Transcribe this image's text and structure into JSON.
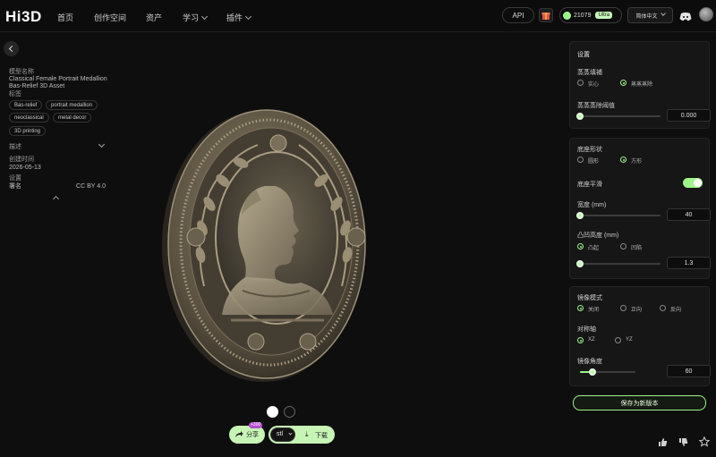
{
  "brand": {
    "logo": "Hi3D"
  },
  "nav": {
    "items": [
      {
        "label": "首页"
      },
      {
        "label": "创作空间"
      },
      {
        "label": "资产"
      },
      {
        "label": "学习"
      },
      {
        "label": "插件"
      }
    ]
  },
  "header": {
    "api_label": "API",
    "credits": "21079",
    "plan_badge": "Ultra",
    "language": "简体中文"
  },
  "asset": {
    "name_label": "模型名称",
    "name_value": "Classical Female Portrait Medallion Bas-Relief 3D Asset",
    "tags_label": "标签",
    "tags": [
      "Bas-relief",
      "portrait medallion",
      "neoclassical",
      "metal decor",
      "3D printing"
    ],
    "desc_label": "描述",
    "created_label": "创建时间",
    "created_value": "2026-05-13",
    "settings_label": "设置",
    "license_type": "署名",
    "license_value": "CC BY 4.0"
  },
  "settings": {
    "title": "设置",
    "fill_mode_label": "蒸蒸填補",
    "fill_options": [
      "实心",
      "蒸蒸蒸除"
    ],
    "fill_selected": 1,
    "threshold_label": "蒸蒸蒸除阈值",
    "threshold_value": "0.000",
    "threshold_level": 0,
    "base_shape_label": "底座形状",
    "shape_options": [
      "圆形",
      "方形"
    ],
    "shape_selected": 1,
    "smooth_label": "底座平滑",
    "smooth_on": true,
    "width_label": "宽度 (mm)",
    "width_value": "40",
    "width_level": 0,
    "thickness_label": "凸凹高度 (mm)",
    "thickness_options": [
      "凸起",
      "凹陷"
    ],
    "thickness_selected": 0,
    "thickness_value": "1.3",
    "thickness_level": 0,
    "mirror_mode_label": "镜像模式",
    "mirror_options": [
      "关闭",
      "正向",
      "反向"
    ],
    "mirror_selected": 0,
    "axis_label": "对称轴",
    "axis_options": [
      "XZ",
      "YZ"
    ],
    "axis_selected": 0,
    "angle_label": "镜像角度",
    "angle_value": "60",
    "angle_level": 0.23,
    "save_button": "保存为新版本"
  },
  "footer": {
    "share_label": "分享",
    "share_badge": "+300",
    "format_value": "stl",
    "download_label": "下载"
  },
  "colors": {
    "accent": "#9ef58a",
    "panel": "#161616",
    "background": "#0e0e0e"
  }
}
